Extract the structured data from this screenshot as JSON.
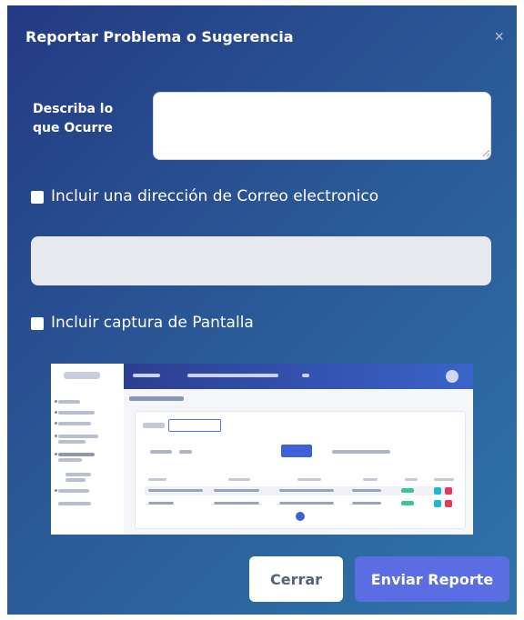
{
  "modal": {
    "title": "Reportar Problema o Sugerencia",
    "close_icon": "×"
  },
  "form": {
    "describe_label": "Describa lo que Ocurre",
    "describe_value": "",
    "email_checkbox_label": "Incluir una dirección de Correo electronico",
    "email_value": "",
    "screenshot_checkbox_label": "Incluir captura de Pantalla"
  },
  "buttons": {
    "close_label": "Cerrar",
    "send_label": "Enviar Reporte"
  },
  "colors": {
    "modal_gradient_start": "#243a84",
    "modal_gradient_end": "#2f74a9",
    "primary_button": "#5a6de3"
  },
  "icons": {
    "close": "close-icon",
    "resize": "resize-grip-icon"
  }
}
